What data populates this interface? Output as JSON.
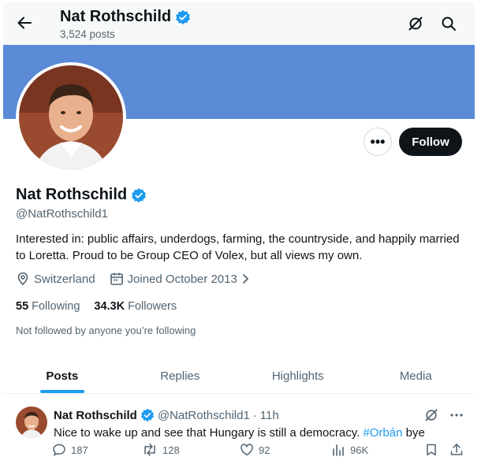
{
  "header": {
    "name": "Nat Rothschild",
    "posts_count": "3,524 posts",
    "icons": [
      "back-arrow-icon",
      "grok-icon",
      "search-icon"
    ]
  },
  "profile": {
    "name": "Nat Rothschild",
    "handle": "@NatRothschild1",
    "bio": "Interested in: public affairs, underdogs, farming, the countryside, and happily married to Loretta. Proud to be Group CEO of Volex, but all views my own.",
    "location": "Switzerland",
    "joined": "Joined October 2013",
    "following_count": "55",
    "following_label": "Following",
    "followers_count": "34.3K",
    "followers_label": "Followers",
    "not_followed": "Not followed by anyone you’re following",
    "more_label": "•••",
    "follow_label": "Follow"
  },
  "tabs": [
    {
      "label": "Posts",
      "active": true
    },
    {
      "label": "Replies",
      "active": false
    },
    {
      "label": "Highlights",
      "active": false
    },
    {
      "label": "Media",
      "active": false
    }
  ],
  "tweet": {
    "name": "Nat Rothschild",
    "handle": "@NatRothschild1",
    "dot": "·",
    "time": "11h",
    "text_before": "Nice to wake up and see that Hungary is still a democracy. ",
    "hashtag": "#Orbán",
    "text_after": " bye",
    "replies": "187",
    "reposts": "128",
    "likes": "92",
    "views": "96K"
  },
  "colors": {
    "banner": "#5b8ad6",
    "verified": "#1d9bf0",
    "accent": "#1d9bf0",
    "follow_button": "#0f1419"
  }
}
